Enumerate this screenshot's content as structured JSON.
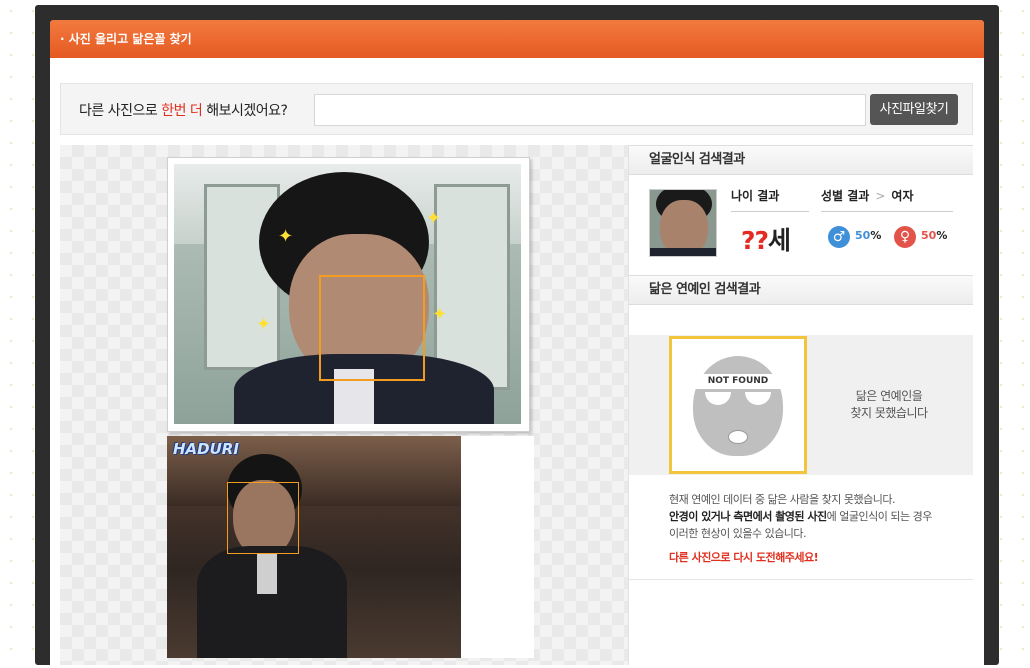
{
  "header": {
    "title": "· 사진 올리고 닮은꼴 찾기"
  },
  "search": {
    "prompt_pre": "다른 사진으로 ",
    "prompt_red": "한번 더",
    "prompt_post": " 해보시겠어요?",
    "file_value": "",
    "button_label": "사진파일찾기"
  },
  "photos": {
    "watermark": "HADURI"
  },
  "face_result": {
    "heading": "얼굴인식 검색결과",
    "age_label": "나이 결과",
    "age_q": "??",
    "age_unit": "세",
    "gender_label": "성별 결과",
    "gender_sep": ">",
    "gender_value": "여자",
    "male_symbol": "♂",
    "male_pct": "50",
    "female_symbol": "♀",
    "female_pct": "50",
    "pct_unit": "%"
  },
  "celebrity": {
    "heading": "닮은 연예인 검색결과",
    "not_found_label": "NOT FOUND",
    "message_line1": "닮은 연예인을",
    "message_line2": "찾지 못했습니다",
    "notice_line1": "현재 연예인 데이터 중 닮은 사람을 찾지 못했습니다.",
    "notice_line2_bold": "안경이 있거나 측면에서 촬영된 사진",
    "notice_line2_rest": "에 얼굴인식이 되는 경우",
    "notice_line3": "이러한 현상이 있을수 있습니다.",
    "notice_red": "다른 사진으로 다시 도전해주세요!"
  },
  "colors": {
    "header": "#e55a22",
    "accent_red": "#e03020",
    "face_box": "#f39c1f",
    "male": "#3f8fd9",
    "female": "#e2534a"
  }
}
